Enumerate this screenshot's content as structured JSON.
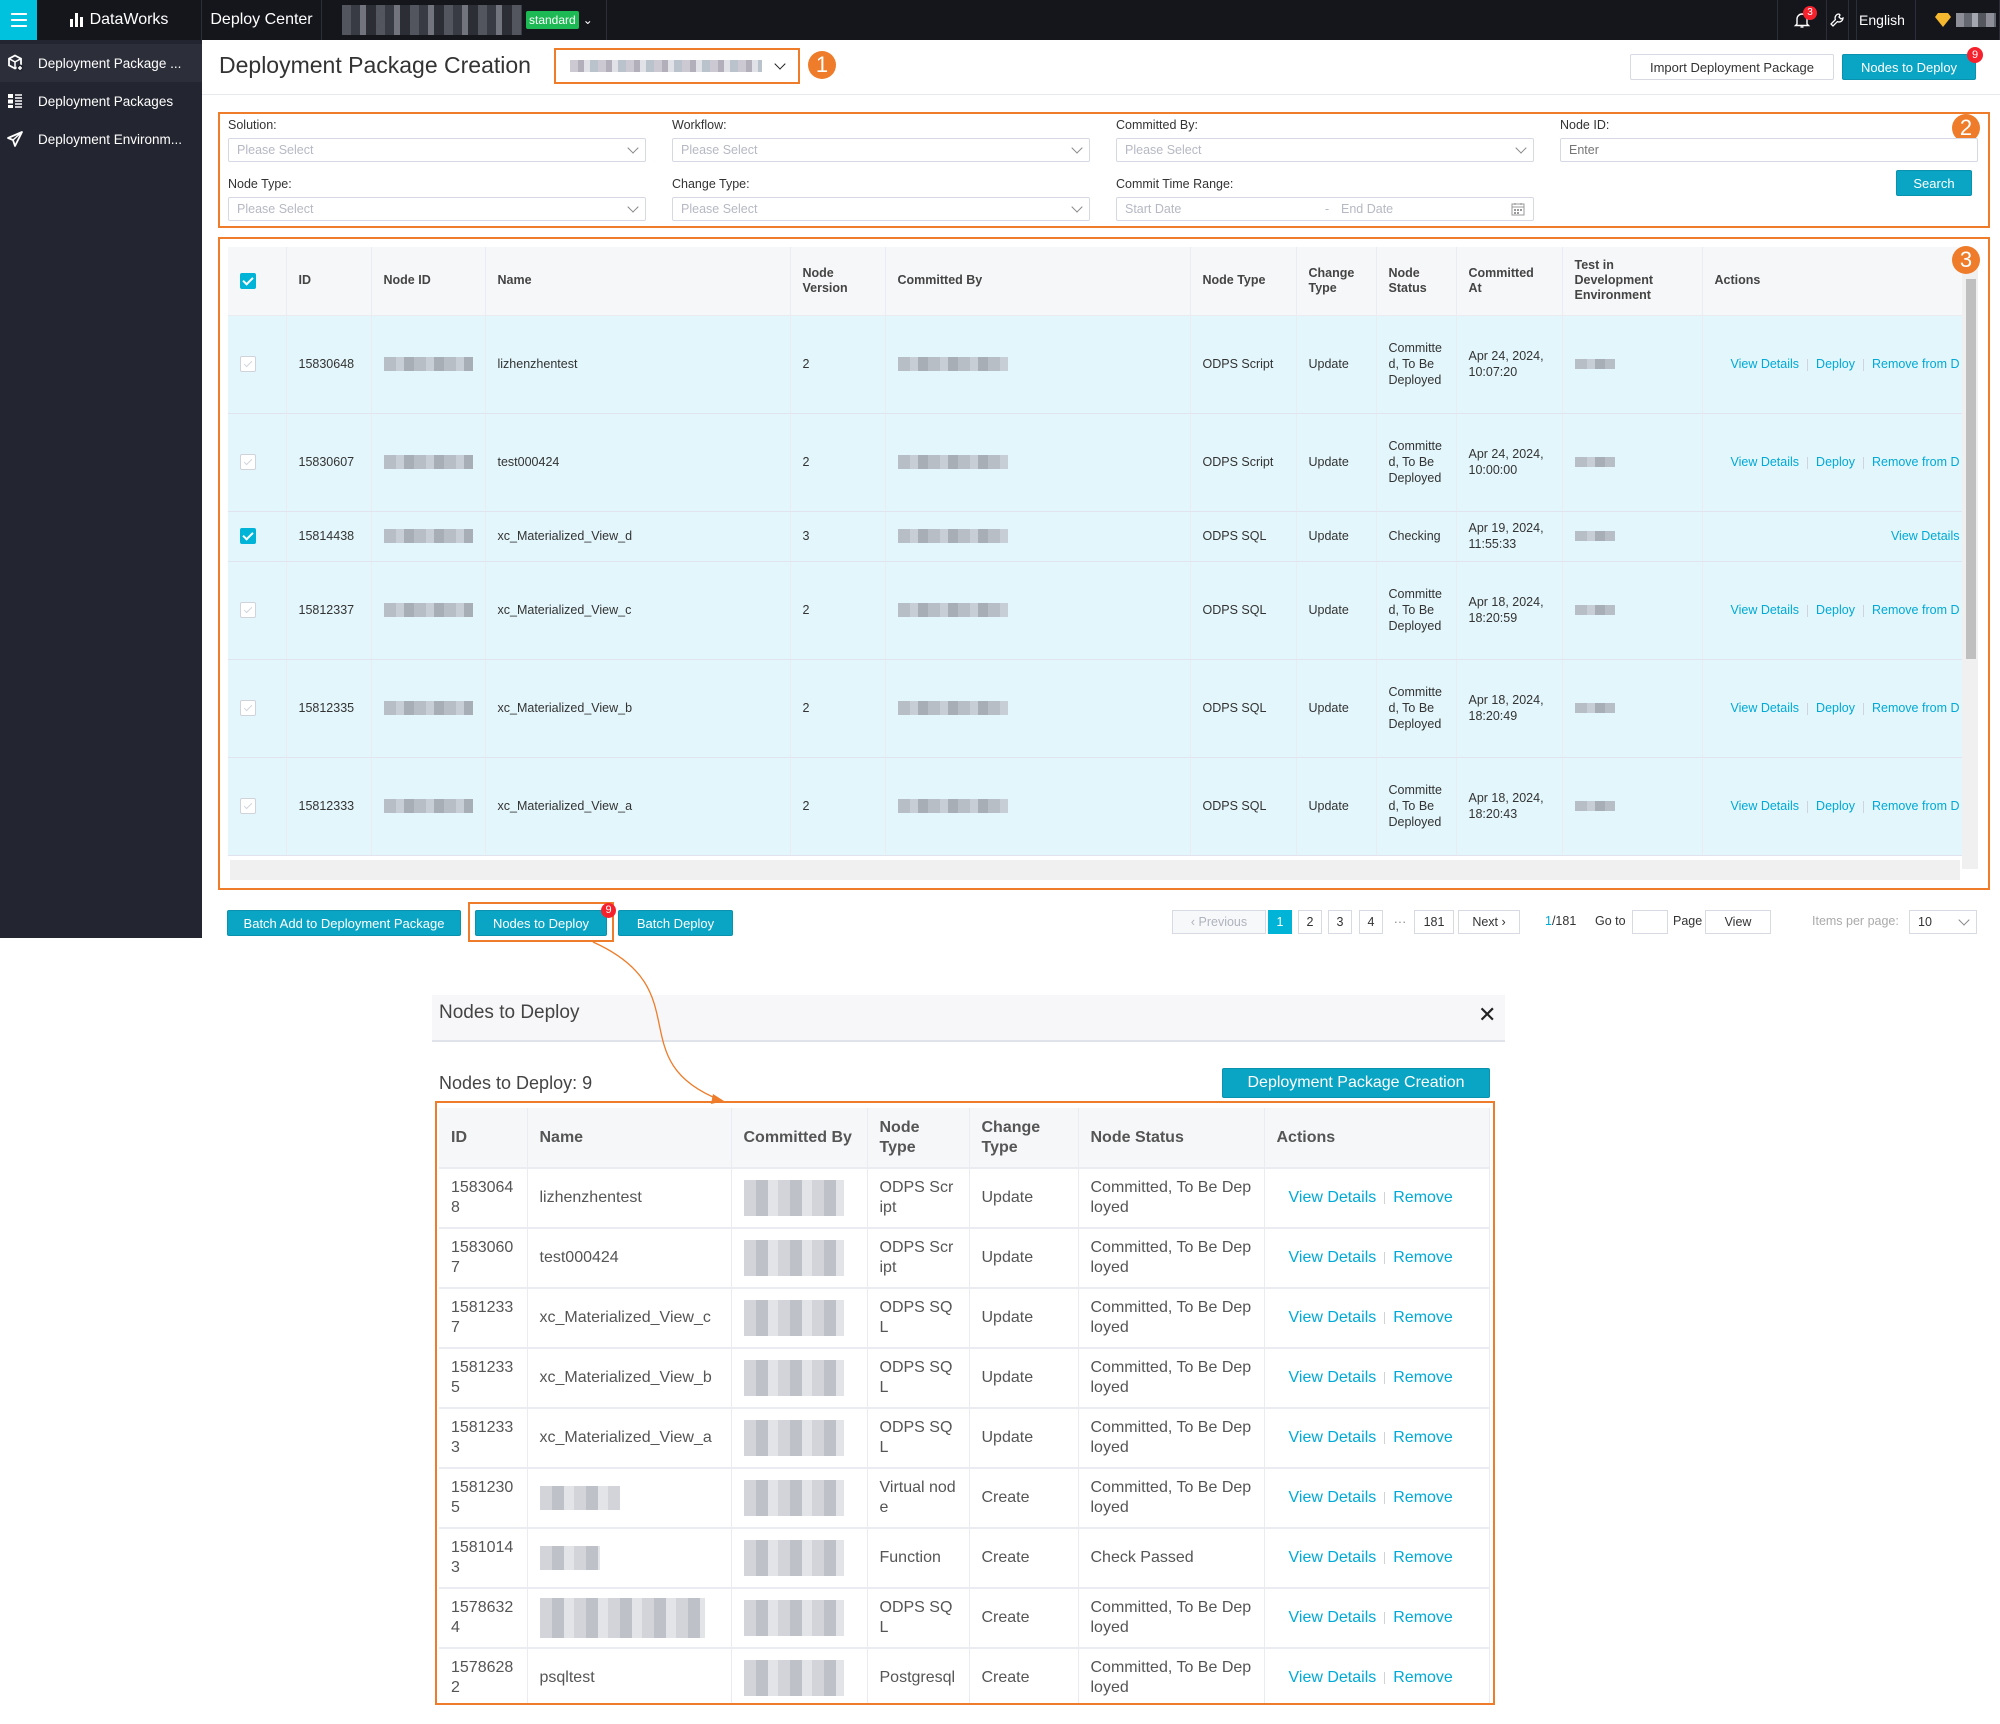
{
  "topbar": {
    "brand": "DataWorks",
    "module": "Deploy Center",
    "workspace_env_badge": "standard",
    "notification_count": "3",
    "language": "English"
  },
  "sidebar": {
    "items": [
      {
        "label": "Deployment Package ...",
        "icon": "package-add-icon",
        "active": true
      },
      {
        "label": "Deployment Packages",
        "icon": "list-icon",
        "active": false
      },
      {
        "label": "Deployment Environm...",
        "icon": "paper-plane-icon",
        "active": false
      }
    ]
  },
  "header": {
    "title": "Deployment Package Creation",
    "import_button": "Import Deployment Package",
    "nodes_to_deploy_button": "Nodes to Deploy",
    "nodes_to_deploy_count": "9"
  },
  "callouts": [
    "1",
    "2",
    "3"
  ],
  "filters": {
    "solution": {
      "label": "Solution:",
      "placeholder": "Please Select"
    },
    "workflow": {
      "label": "Workflow:",
      "placeholder": "Please Select"
    },
    "committed_by": {
      "label": "Committed By:",
      "placeholder": "Please Select"
    },
    "node_id": {
      "label": "Node ID:",
      "placeholder": "Enter"
    },
    "node_type": {
      "label": "Node Type:",
      "placeholder": "Please Select"
    },
    "change_type": {
      "label": "Change Type:",
      "placeholder": "Please Select"
    },
    "commit_time_range": {
      "label": "Commit Time Range:",
      "start_placeholder": "Start Date",
      "end_placeholder": "End Date",
      "separator": "-"
    },
    "search_button": "Search"
  },
  "table": {
    "columns": [
      "ID",
      "Node ID",
      "Name",
      "Node Version",
      "Committed By",
      "Node Type",
      "Change Type",
      "Node Status",
      "Committed At",
      "Test in Development Environment",
      "Actions"
    ],
    "rows": [
      {
        "checked": false,
        "disabled": true,
        "id": "15830648",
        "name": "lizhenzhentest",
        "version": "2",
        "node_type": "ODPS Script",
        "change_type": "Update",
        "status": "Committed, To Be Deployed",
        "status_kind": "green",
        "committed_at": "Apr 24, 2024, 10:07:20",
        "actions": [
          "View Details",
          "Deploy",
          "Remove from D"
        ]
      },
      {
        "checked": false,
        "disabled": true,
        "id": "15830607",
        "name": "test000424",
        "version": "2",
        "node_type": "ODPS Script",
        "change_type": "Update",
        "status": "Committed, To Be Deployed",
        "status_kind": "green",
        "committed_at": "Apr 24, 2024, 10:00:00",
        "actions": [
          "View Details",
          "Deploy",
          "Remove from D"
        ]
      },
      {
        "checked": true,
        "disabled": false,
        "id": "15814438",
        "name": "xc_Materialized_View_d",
        "version": "3",
        "node_type": "ODPS SQL",
        "change_type": "Update",
        "status": "Checking",
        "status_kind": "orange",
        "committed_at": "Apr 19, 2024, 11:55:33",
        "actions": [
          "View Details"
        ]
      },
      {
        "checked": false,
        "disabled": true,
        "id": "15812337",
        "name": "xc_Materialized_View_c",
        "version": "2",
        "node_type": "ODPS SQL",
        "change_type": "Update",
        "status": "Committed, To Be Deployed",
        "status_kind": "green",
        "committed_at": "Apr 18, 2024, 18:20:59",
        "actions": [
          "View Details",
          "Deploy",
          "Remove from D"
        ]
      },
      {
        "checked": false,
        "disabled": true,
        "id": "15812335",
        "name": "xc_Materialized_View_b",
        "version": "2",
        "node_type": "ODPS SQL",
        "change_type": "Update",
        "status": "Committed, To Be Deployed",
        "status_kind": "green",
        "committed_at": "Apr 18, 2024, 18:20:49",
        "actions": [
          "View Details",
          "Deploy",
          "Remove from D"
        ]
      },
      {
        "checked": false,
        "disabled": true,
        "id": "15812333",
        "name": "xc_Materialized_View_a",
        "version": "2",
        "node_type": "ODPS SQL",
        "change_type": "Update",
        "status": "Committed, To Be Deployed",
        "status_kind": "green",
        "committed_at": "Apr 18, 2024, 18:20:43",
        "actions": [
          "View Details",
          "Deploy",
          "Remove from D"
        ]
      }
    ]
  },
  "bottom_actions": {
    "batch_add": "Batch Add to Deployment Package",
    "nodes_to_deploy": "Nodes to Deploy",
    "nodes_to_deploy_count": "9",
    "batch_deploy": "Batch Deploy"
  },
  "pagination": {
    "previous": "Previous",
    "pages": [
      "1",
      "2",
      "3",
      "4"
    ],
    "ellipsis": "···",
    "last_page": "181",
    "next": "Next",
    "current": "1",
    "total": "/181",
    "goto_label": "Go to",
    "page_label": "Page",
    "view_button": "View",
    "items_per_page_label": "Items per page:",
    "items_per_page": "10"
  },
  "dialog": {
    "title": "Nodes to Deploy",
    "count_label": "Nodes to Deploy: 9",
    "create_button": "Deployment Package Creation",
    "columns": [
      "ID",
      "Name",
      "Committed By",
      "Node Type",
      "Change Type",
      "Node Status",
      "Actions"
    ],
    "rows": [
      {
        "id": "15830648",
        "name": "lizhenzhentest",
        "node_type": "ODPS Script",
        "change_type": "Update",
        "status": "Committed, To Be Deployed",
        "actions": [
          "View Details",
          "Remove"
        ]
      },
      {
        "id": "15830607",
        "name": "test000424",
        "node_type": "ODPS Script",
        "change_type": "Update",
        "status": "Committed, To Be Deployed",
        "actions": [
          "View Details",
          "Remove"
        ]
      },
      {
        "id": "15812337",
        "name": "xc_Materialized_View_c",
        "node_type": "ODPS SQL",
        "change_type": "Update",
        "status": "Committed, To Be Deployed",
        "actions": [
          "View Details",
          "Remove"
        ]
      },
      {
        "id": "15812335",
        "name": "xc_Materialized_View_b",
        "node_type": "ODPS SQL",
        "change_type": "Update",
        "status": "Committed, To Be Deployed",
        "actions": [
          "View Details",
          "Remove"
        ]
      },
      {
        "id": "15812333",
        "name": "xc_Materialized_View_a",
        "node_type": "ODPS SQL",
        "change_type": "Update",
        "status": "Committed, To Be Deployed",
        "actions": [
          "View Details",
          "Remove"
        ]
      },
      {
        "id": "15812305",
        "name": "",
        "node_type": "Virtual node",
        "change_type": "Create",
        "status": "Committed, To Be Deployed",
        "actions": [
          "View Details",
          "Remove"
        ]
      },
      {
        "id": "15810143",
        "name": "",
        "node_type": "Function",
        "change_type": "Create",
        "status": "Check Passed",
        "actions": [
          "View Details",
          "Remove"
        ]
      },
      {
        "id": "15786324",
        "name": "",
        "node_type": "ODPS SQL",
        "change_type": "Create",
        "status": "Committed, To Be Deployed",
        "actions": [
          "View Details",
          "Remove"
        ]
      },
      {
        "id": "15786282",
        "name": "psqltest",
        "node_type": "Postgresql",
        "change_type": "Create",
        "status": "Committed, To Be Deployed",
        "actions": [
          "View Details",
          "Remove"
        ]
      }
    ]
  },
  "colors": {
    "accent": "#0aa5c4",
    "annotation": "#ee7c2a",
    "status_green": "#3bb54a",
    "status_orange": "#f5b12f",
    "link": "#00a9d6",
    "badge_red": "#f5222d"
  }
}
